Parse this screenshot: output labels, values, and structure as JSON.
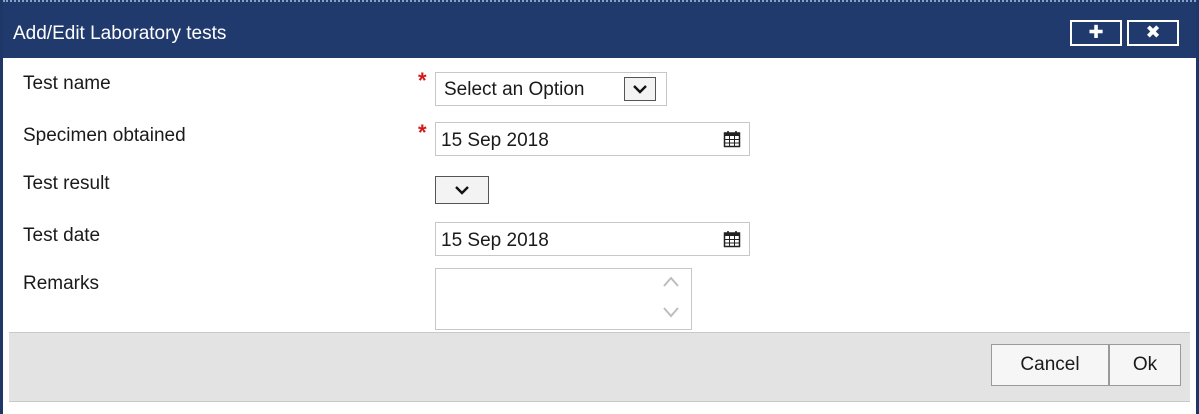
{
  "dialog": {
    "title": "Add/Edit Laboratory tests",
    "add_icon": "plus-icon",
    "close_icon": "close-icon",
    "add_glyph": "✚",
    "close_glyph": "✖"
  },
  "form": {
    "test_name": {
      "label": "Test name",
      "required": true,
      "value": "Select an Option"
    },
    "specimen_obtained": {
      "label": "Specimen obtained",
      "required": true,
      "value": "15 Sep 2018"
    },
    "test_result": {
      "label": "Test result",
      "value": ""
    },
    "test_date": {
      "label": "Test date",
      "value": "15 Sep 2018"
    },
    "remarks": {
      "label": "Remarks",
      "value": ""
    },
    "required_mark": "*"
  },
  "footer": {
    "cancel_label": "Cancel",
    "ok_label": "Ok"
  },
  "colors": {
    "titlebar": "#213a6d",
    "required": "#d11a1a",
    "footer_bg": "#e3e3e3"
  }
}
